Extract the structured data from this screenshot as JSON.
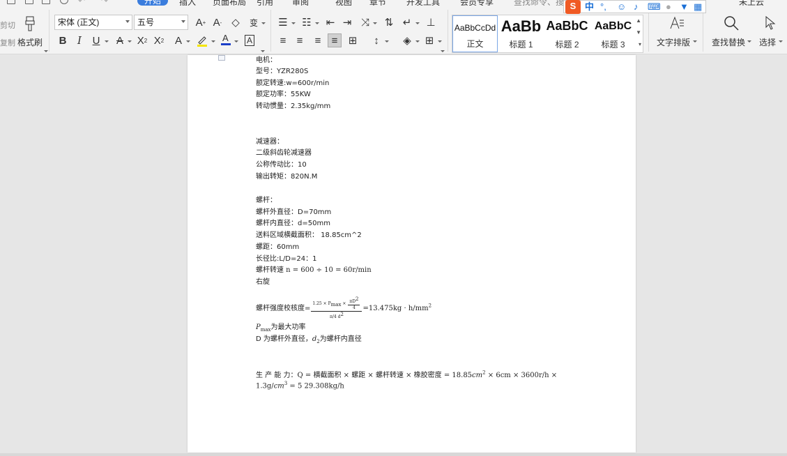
{
  "menu": {
    "tabs": [
      "开始",
      "插入",
      "页面布局",
      "引用",
      "审阅",
      "视图",
      "章节",
      "开发工具",
      "会员专享"
    ],
    "active_tab": "开始",
    "search_placeholder": "查找命令、搜索模板",
    "user_label": "未上云"
  },
  "ribbon": {
    "clipboard": {
      "cut_label": "剪切",
      "copy_label": "复制",
      "format_painter_label": "格式刷"
    },
    "font": {
      "font_family": "宋体 (正文)",
      "font_size": "五号",
      "buttons": [
        "A+",
        "A-",
        "清除格式",
        "拼音指南",
        "B",
        "I",
        "U",
        "删除线",
        "上标",
        "下标",
        "文字效果",
        "突出显示",
        "字体颜色",
        "字符边框"
      ]
    },
    "paragraph": {
      "buttons": [
        "项目符号",
        "编号",
        "减少缩进",
        "增加缩进",
        "中文版式",
        "排序",
        "显示/隐藏",
        "制表位",
        "左对齐",
        "居中",
        "右对齐",
        "两端对齐",
        "分散对齐",
        "行距",
        "底纹",
        "边框"
      ]
    },
    "styles": [
      {
        "preview": "AaBbCcDd",
        "label": "正文"
      },
      {
        "preview": "AaBb",
        "label": "标题 1"
      },
      {
        "preview": "AaBbC",
        "label": "标题 2"
      },
      {
        "preview": "AaBbC",
        "label": "标题 3"
      }
    ],
    "text_layout_label": "文字排版",
    "find_replace_label": "查找替换",
    "select_label": "选择"
  },
  "ime": {
    "lang": "中",
    "punct": "°,",
    "logo": "S"
  },
  "document": {
    "lines_motor": [
      "电机：",
      "型号：YZR280S",
      "额定转速:w=600r/min",
      "额定功率：55KW",
      "转动惯量：2.35kg/mm"
    ],
    "lines_reducer": [
      "减速器：",
      "二级斜齿轮减速器",
      "公称传动比：10",
      "输出转矩：820N.M"
    ],
    "lines_screw": [
      "螺杆：",
      "螺杆外直径：D=70mm",
      "螺杆内直径：d=50mm",
      "送料区域横截面积：  18.85cm^2",
      "螺距：60mm",
      "长径比:L/D=24：1",
      "螺杆转速 n = 600 ÷ 10 = 60r/min",
      "右旋"
    ],
    "strength": {
      "label": "螺杆强度校核度=",
      "num_a": "1.25 × P",
      "num_sub": "max",
      "num_b": " × ",
      "num_c": "πD",
      "num_c_sup": "2",
      "num_c_den": "4",
      "den": "π/4 d",
      "den_sup": "2",
      "result": "=13.475kg · h/mm",
      "result_sup": "2"
    },
    "pmax_line": {
      "sym": "P",
      "sub": "max",
      "text": "为最大功率"
    },
    "dd_line": {
      "a": "D 为螺杆外直径，",
      "sym": "d",
      "sub": "2",
      "b": "为螺杆内直径"
    },
    "capacity_1": "生 产 能 力：Q =  横截面积 × 螺距 × 螺杆转速 × 橡胶密度 = 18.85",
    "capacity_1_unit": "cm",
    "capacity_1_sup": "2",
    "capacity_1_tail": " × 6cm × 3600r/h ×",
    "capacity_2_a": "1.3g/",
    "capacity_2_unit": "cm",
    "capacity_2_sup": "3",
    "capacity_2_tail": " = 5 29.308kg/h"
  }
}
